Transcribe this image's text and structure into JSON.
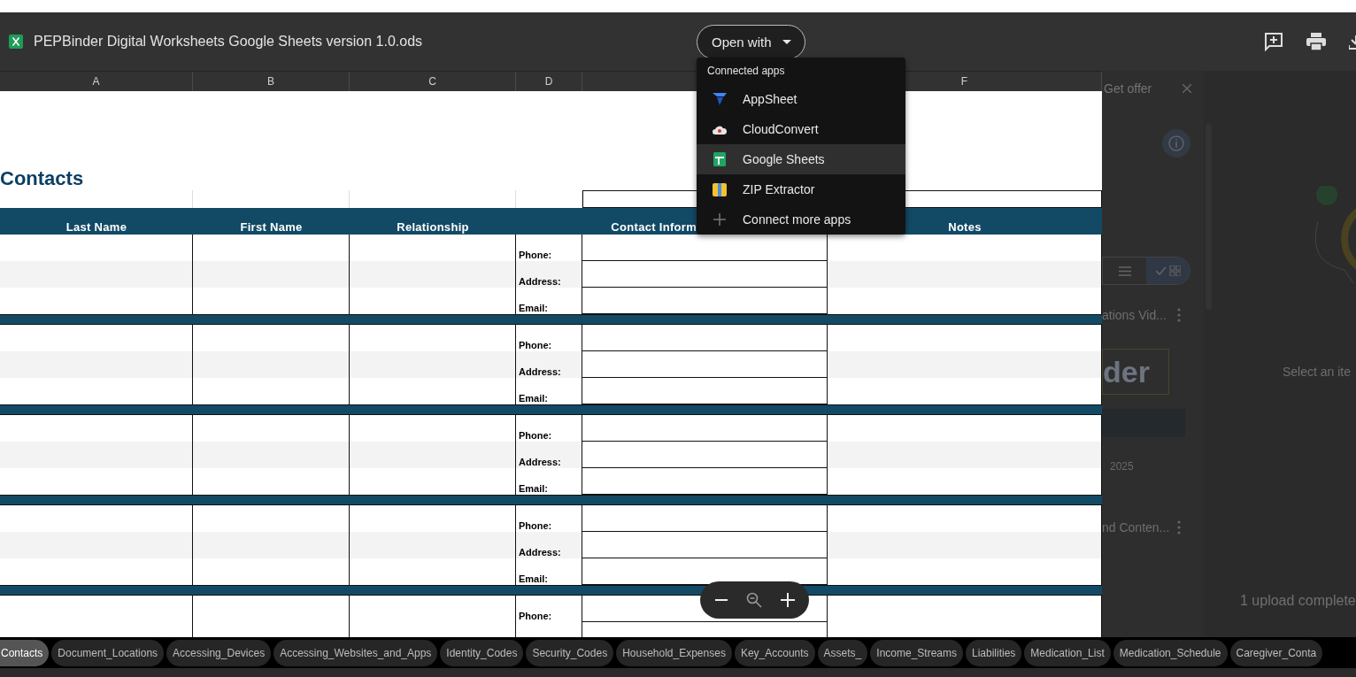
{
  "file": {
    "title": "PEPBinder Digital Worksheets Google Sheets version 1.0.ods",
    "open_with": "Open with"
  },
  "columns": [
    "A",
    "B",
    "C",
    "D",
    "F"
  ],
  "sheet": {
    "title": "Contacts",
    "headers": [
      "Last Name",
      "First Name",
      "Relationship",
      "Contact Inform",
      "Notes"
    ],
    "groups": [
      {
        "fields": [
          "Phone:",
          "Address:",
          "Email:"
        ]
      },
      {
        "fields": [
          "Phone:",
          "Address:",
          "Email:"
        ]
      },
      {
        "fields": [
          "Phone:",
          "Address:",
          "Email:"
        ]
      },
      {
        "fields": [
          "Phone:",
          "Address:",
          "Email:"
        ]
      },
      {
        "fields": [
          "Phone:"
        ]
      }
    ]
  },
  "menu": {
    "heading": "Connected apps",
    "items": [
      {
        "label": "AppSheet",
        "kind": "appsheet",
        "selected": false
      },
      {
        "label": "CloudConvert",
        "kind": "cloud",
        "selected": false
      },
      {
        "label": "Google Sheets",
        "kind": "sheets",
        "selected": true
      },
      {
        "label": "ZIP Extractor",
        "kind": "zip",
        "selected": false
      },
      {
        "label": "Connect more apps",
        "kind": "add",
        "selected": false
      }
    ]
  },
  "backdrop": {
    "offer": "Get offer",
    "cards": [
      {
        "title": "ations Vid...",
        "logo": "der",
        "date": "2025"
      },
      {
        "title": "nd Conten..."
      }
    ],
    "empty_state": "Select an ite",
    "upload_status": "1 upload complete"
  },
  "tabs": [
    {
      "label": "Contacts",
      "selected": true
    },
    {
      "label": "Document_Locations",
      "selected": false
    },
    {
      "label": "Accessing_Devices",
      "selected": false
    },
    {
      "label": "Accessing_Websites_and_Apps",
      "selected": false
    },
    {
      "label": "Identity_Codes",
      "selected": false
    },
    {
      "label": "Security_Codes",
      "selected": false
    },
    {
      "label": "Household_Expenses",
      "selected": false
    },
    {
      "label": "Key_Accounts",
      "selected": false
    },
    {
      "label": "Assets_",
      "selected": false
    },
    {
      "label": "Income_Streams",
      "selected": false
    },
    {
      "label": "Liabilities",
      "selected": false
    },
    {
      "label": "Medication_List",
      "selected": false
    },
    {
      "label": "Medication_Schedule",
      "selected": false
    },
    {
      "label": "Caregiver_Conta",
      "selected": false
    }
  ]
}
